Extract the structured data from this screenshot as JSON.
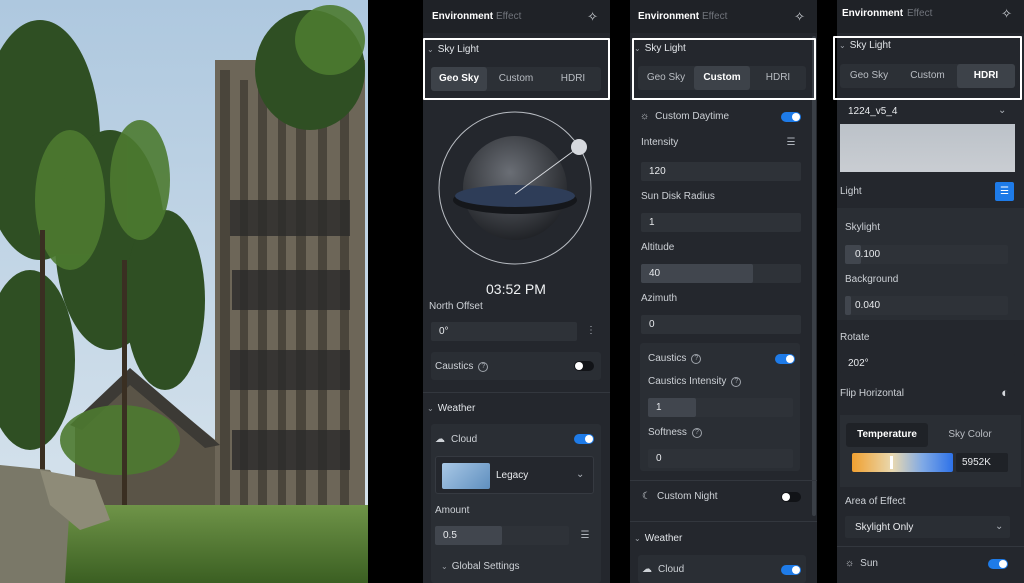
{
  "render": {
    "sky_color": "#c4d6e6",
    "foliage_color": "#3f6a2c"
  },
  "accent": "#1e7be8",
  "panels": [
    {
      "tabs": {
        "environment": "Environment",
        "effect": "Effect"
      },
      "sky_light": {
        "title": "Sky Light",
        "options": [
          "Geo Sky",
          "Custom",
          "HDRI"
        ],
        "selected": "Geo Sky"
      },
      "time": "03:52 PM",
      "north_offset": {
        "label": "North Offset",
        "value": "0°"
      },
      "caustics": {
        "label": "Caustics",
        "enabled": false
      },
      "weather": {
        "title": "Weather",
        "cloud": {
          "label": "Cloud",
          "enabled": true,
          "preset": "Legacy"
        },
        "amount": {
          "label": "Amount",
          "value": "0.5",
          "fraction": 0.5
        },
        "global_settings": "Global Settings"
      }
    },
    {
      "tabs": {
        "environment": "Environment",
        "effect": "Effect"
      },
      "sky_light": {
        "title": "Sky Light",
        "options": [
          "Geo Sky",
          "Custom",
          "HDRI"
        ],
        "selected": "Custom"
      },
      "custom_daytime": {
        "label": "Custom Daytime",
        "enabled": true
      },
      "intensity": {
        "label": "Intensity",
        "value": "120"
      },
      "sun_disk_radius": {
        "label": "Sun Disk Radius",
        "value": "1"
      },
      "altitude": {
        "label": "Altitude",
        "value": "40",
        "fraction": 0.7
      },
      "azimuth": {
        "label": "Azimuth",
        "value": "0"
      },
      "caustics": {
        "label": "Caustics",
        "enabled": true
      },
      "caustics_intensity": {
        "label": "Caustics Intensity",
        "value": "1"
      },
      "softness": {
        "label": "Softness",
        "value": "0"
      },
      "custom_night": {
        "label": "Custom Night",
        "enabled": false
      },
      "weather": {
        "title": "Weather",
        "cloud": {
          "label": "Cloud",
          "enabled": true
        }
      }
    },
    {
      "tabs": {
        "environment": "Environment",
        "effect": "Effect"
      },
      "sky_light": {
        "title": "Sky Light",
        "options": [
          "Geo Sky",
          "Custom",
          "HDRI"
        ],
        "selected": "HDRI"
      },
      "hdri_name": "1224_v5_4",
      "light": {
        "label": "Light"
      },
      "skylight": {
        "label": "Skylight",
        "value": "0.100"
      },
      "background": {
        "label": "Background",
        "value": "0.040"
      },
      "rotate": {
        "label": "Rotate",
        "value": "202°"
      },
      "flip_horizontal": {
        "label": "Flip Horizontal"
      },
      "color_tabs": [
        "Temperature",
        "Sky Color"
      ],
      "temperature": {
        "value": "5952K"
      },
      "area_of_effect": {
        "label": "Area of Effect",
        "value": "Skylight Only"
      },
      "sun": {
        "label": "Sun",
        "enabled": true
      }
    }
  ]
}
